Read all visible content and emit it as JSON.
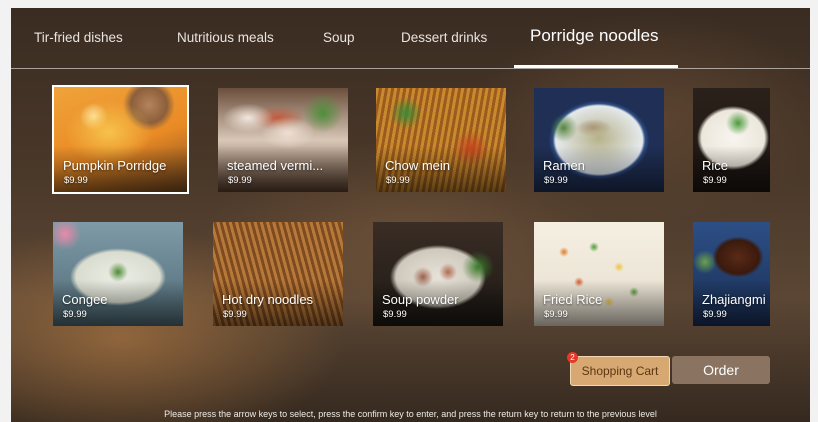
{
  "tabs": [
    {
      "label": "Tir-fried dishes"
    },
    {
      "label": "Nutritious meals"
    },
    {
      "label": "Soup"
    },
    {
      "label": "Dessert drinks"
    },
    {
      "label": "Porridge noodles",
      "active": true
    }
  ],
  "dishes": [
    {
      "name": "Pumpkin Porridge",
      "price": "$9.99",
      "focused": true
    },
    {
      "name": "steamed vermi...",
      "price": "$9.99"
    },
    {
      "name": "Chow mein",
      "price": "$9.99"
    },
    {
      "name": "Ramen",
      "price": "$9.99"
    },
    {
      "name": "Rice",
      "price": "$9.99"
    },
    {
      "name": "Congee",
      "price": "$9.99"
    },
    {
      "name": "Hot dry noodles",
      "price": "$9.99"
    },
    {
      "name": "Soup powder",
      "price": "$9.99"
    },
    {
      "name": "Fried Rice",
      "price": "$9.99"
    },
    {
      "name": "Zhajiangmi",
      "price": "$9.99"
    }
  ],
  "cart": {
    "label": "Shopping Cart",
    "badge": "2"
  },
  "order": {
    "label": "Order"
  },
  "hint": "Please press the arrow keys to select, press the confirm key to enter, and press the return key to return to the previous level"
}
